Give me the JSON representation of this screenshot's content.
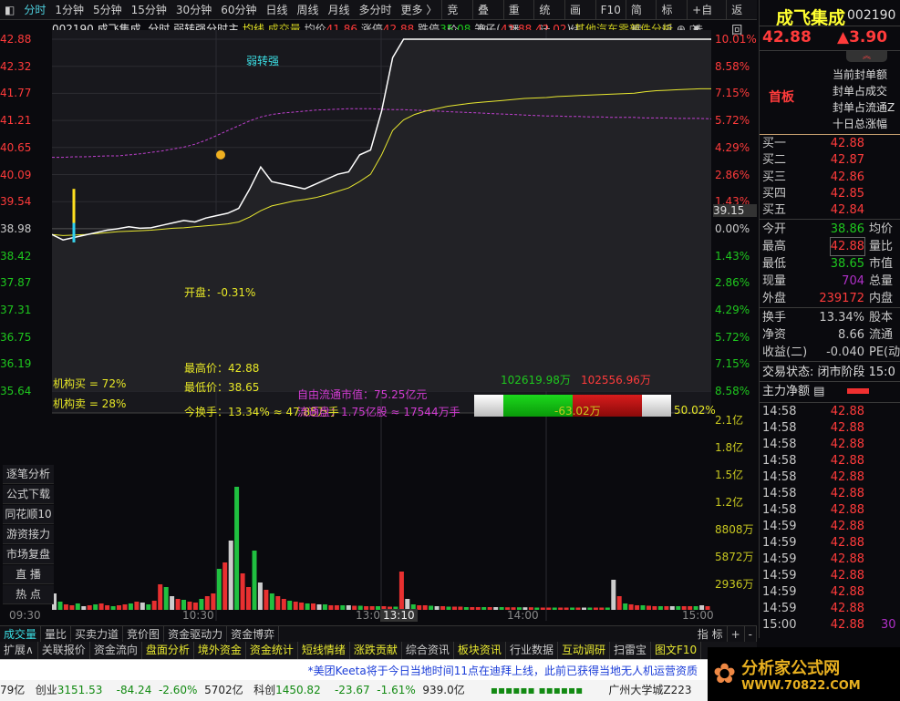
{
  "toolbar": {
    "periods": [
      "分时",
      "1分钟",
      "5分钟",
      "15分钟",
      "30分钟",
      "60分钟",
      "日线",
      "周线",
      "月线",
      "多分时",
      "更多 〉"
    ],
    "buttons": [
      "竞价",
      "叠加",
      "重播",
      "统计",
      "画线",
      "F10",
      "简框",
      "标记",
      "+自选",
      "返回"
    ]
  },
  "info": {
    "code_name": "002190 成飞集成",
    "mode": "分时",
    "formula": "弱转强分时主",
    "avg_line": "均线",
    "volume": "成交量",
    "avg_label": "均价",
    "avg": "41.86",
    "up_label": "涨停",
    "up": "42.88",
    "down_label": "跌停",
    "down": "35.08",
    "cage_label": "笼子(",
    "cage1": "42.88",
    "cage2": "42.02",
    "cage_end": ")",
    "sector": "其他汽车零部件分析"
  },
  "left_axis": [
    "42.88",
    "42.32",
    "41.77",
    "41.21",
    "40.65",
    "40.09",
    "39.54",
    "38.98",
    "38.42",
    "37.87",
    "37.31",
    "36.75",
    "36.19",
    "35.64"
  ],
  "right_axis": [
    "10.01%",
    "8.58%",
    "7.15%",
    "5.72%",
    "4.29%",
    "2.86%",
    "1.43%",
    "0.00%",
    "1.43%",
    "2.86%",
    "4.29%",
    "5.72%",
    "7.15%",
    "8.58%"
  ],
  "cursor_price": "39.15",
  "annotations": {
    "weak_strong": "弱转强",
    "open": "开盘：-0.31%",
    "high": "最高价：42.88",
    "low": "最低价：38.65",
    "turnover": "今换手：13.34% ≈ 47.85万手",
    "free_float": "自由流通市值：75.25亿元",
    "float_shares": "流通盘：1.75亿股 ≈ 17544万手",
    "inst_buy": "机构买 = 72%",
    "inst_sell": "机构卖 = 28%",
    "buy_amt": "102619.98万",
    "sell_amt": "102556.96万",
    "net": "-63.02万",
    "ratio": "50.02%"
  },
  "vol_axis": [
    "2.1亿",
    "1.8亿",
    "1.5亿",
    "1.2亿",
    "8808万",
    "5872万",
    "2936万"
  ],
  "time_axis": [
    "09:30",
    "10:30",
    "13:00",
    "14:00",
    "15:00"
  ],
  "cursor_time": "13:10",
  "side_buttons": [
    "逐笔分析",
    "公式下载",
    "同花顺10",
    "游资接力",
    "市场复盘",
    "直 播",
    "热 点"
  ],
  "chart_data": {
    "type": "line",
    "prev_close": 38.98,
    "ylim": [
      35.64,
      42.88
    ],
    "price": [
      38.86,
      38.75,
      38.8,
      38.85,
      38.9,
      38.95,
      38.98,
      39.02,
      38.99,
      39.0,
      39.05,
      39.1,
      39.15,
      39.12,
      39.2,
      39.25,
      39.3,
      39.4,
      39.8,
      40.25,
      39.95,
      39.9,
      39.85,
      39.8,
      39.9,
      40.0,
      40.1,
      40.15,
      40.5,
      40.6,
      41.4,
      42.5,
      42.88,
      42.88,
      42.88,
      42.88,
      42.88,
      42.88,
      42.88,
      42.88,
      42.88,
      42.88,
      42.88,
      42.88,
      42.88,
      42.88,
      42.88,
      42.88,
      42.88,
      42.88,
      42.88,
      42.88,
      42.88,
      42.88,
      42.88,
      42.88,
      42.88,
      42.88,
      42.88,
      42.88,
      42.88
    ],
    "avg": [
      38.86,
      38.84,
      38.85,
      38.86,
      38.88,
      38.9,
      38.92,
      38.93,
      38.94,
      38.95,
      38.97,
      38.99,
      39.0,
      39.02,
      39.04,
      39.06,
      39.08,
      39.12,
      39.22,
      39.35,
      39.45,
      39.5,
      39.55,
      39.58,
      39.62,
      39.68,
      39.75,
      39.82,
      39.95,
      40.1,
      40.5,
      41.0,
      41.22,
      41.33,
      41.4,
      41.45,
      41.5,
      41.53,
      41.56,
      41.58,
      41.6,
      41.62,
      41.64,
      41.66,
      41.67,
      41.68,
      41.7,
      41.71,
      41.72,
      41.73,
      41.74,
      41.75,
      41.76,
      41.77,
      41.8,
      41.82,
      41.83,
      41.84,
      41.85,
      41.86,
      41.86
    ],
    "ma": [
      40.45,
      40.45,
      40.46,
      40.46,
      40.47,
      40.48,
      40.48,
      40.5,
      40.52,
      40.55,
      40.58,
      40.62,
      40.66,
      40.72,
      40.8,
      40.9,
      41.0,
      41.1,
      41.2,
      41.28,
      41.33,
      41.36,
      41.38,
      41.4,
      41.42,
      41.43,
      41.44,
      41.45,
      41.45,
      41.45,
      41.44,
      41.43,
      41.43,
      41.42,
      41.41,
      41.4,
      41.39,
      41.38,
      41.37,
      41.36,
      41.35,
      41.34,
      41.33,
      41.32,
      41.31,
      41.3,
      41.3,
      41.29,
      41.29,
      41.28,
      41.28,
      41.27,
      41.27,
      41.27,
      41.26,
      41.26,
      41.26,
      41.25,
      41.25,
      41.25,
      41.24
    ],
    "volume_wan": [
      1800,
      900,
      600,
      500,
      700,
      400,
      500,
      600,
      700,
      500,
      400,
      500,
      600,
      700,
      900,
      800,
      600,
      1000,
      2800,
      2500,
      1500,
      1200,
      1100,
      900,
      800,
      1200,
      1500,
      1800,
      4500,
      5200,
      7600,
      13500,
      4000,
      2500,
      6500,
      3000,
      2200,
      1800,
      1500,
      1200,
      1000,
      900,
      800,
      700,
      700,
      600,
      600,
      500,
      500,
      500,
      500,
      450,
      450,
      400,
      400,
      400,
      400,
      350,
      350,
      4200,
      1200,
      600,
      500,
      500,
      450,
      400,
      400,
      350,
      350,
      350,
      300,
      300,
      300,
      300,
      300,
      300,
      300,
      280,
      280,
      280,
      280,
      280,
      250,
      250,
      250,
      250,
      250,
      250,
      250,
      250,
      250,
      250,
      250,
      250,
      250,
      3300,
      1500,
      700,
      600,
      500,
      500,
      450,
      400,
      400,
      400,
      400,
      400,
      400,
      400,
      400,
      500,
      400
    ]
  },
  "quote": {
    "name": "成飞集成",
    "code": "002190",
    "price": "42.88",
    "change": "▲3.90",
    "board": "首板",
    "seal": [
      "当前封单额",
      "封单占成交",
      "封单占流通Z",
      "十日总涨幅"
    ],
    "bids": [
      [
        "买一",
        "42.88"
      ],
      [
        "买二",
        "42.87"
      ],
      [
        "买三",
        "42.86"
      ],
      [
        "买四",
        "42.85"
      ],
      [
        "买五",
        "42.84"
      ]
    ],
    "stats": [
      [
        "今开",
        "38.86",
        "均价"
      ],
      [
        "最高",
        "42.88",
        "量比"
      ],
      [
        "最低",
        "38.65",
        "市值"
      ],
      [
        "现量",
        "704",
        "总量"
      ],
      [
        "外盘",
        "239172",
        "内盘"
      ]
    ],
    "stats2": [
      [
        "换手",
        "13.34%",
        "股本"
      ],
      [
        "净资",
        "8.66",
        "流通"
      ],
      [
        "收益(二)",
        "-0.040",
        "PE(动"
      ]
    ],
    "status": "交易状态: 闭市阶段 15:0",
    "net_label": "主力净额",
    "ticks": [
      [
        "14:58",
        "42.88"
      ],
      [
        "14:58",
        "42.88"
      ],
      [
        "14:58",
        "42.88"
      ],
      [
        "14:58",
        "42.88"
      ],
      [
        "14:58",
        "42.88"
      ],
      [
        "14:58",
        "42.88"
      ],
      [
        "14:58",
        "42.88"
      ],
      [
        "14:59",
        "42.88"
      ],
      [
        "14:59",
        "42.88"
      ],
      [
        "14:59",
        "42.88"
      ],
      [
        "14:59",
        "42.88"
      ],
      [
        "14:59",
        "42.88"
      ],
      [
        "14:59",
        "42.88"
      ],
      [
        "15:00",
        "42.88"
      ]
    ],
    "last_vol": "30"
  },
  "bottom_tabs": [
    "成交量",
    "量比",
    "买卖力道",
    "竞价图",
    "资金驱动力",
    "资金博弈"
  ],
  "index_btn": "指 标",
  "info_tabs": [
    "扩展∧",
    "关联报价",
    "资金流向",
    "盘面分析",
    "境外资金",
    "资金统计",
    "短线情绪",
    "涨跌贡献",
    "综合资讯",
    "板块资讯",
    "行业数据",
    "互动调研",
    "扫雷宝",
    "图文F10"
  ],
  "news": "*美团Keeta将于今日当地时间11点在迪拜上线，此前已获得当地无人机运营资质",
  "statusbar": {
    "a": "79亿",
    "cy": "创业",
    "cy_v": "3151.53",
    "cy_c": "-84.24",
    "cy_p": "-2.60%",
    "cy_a": "5702亿",
    "kc": "科创",
    "kc_v": "1450.82",
    "kc_c": "-23.67",
    "kc_p": "-1.61%",
    "kc_a": "939.0亿",
    "loc": "广州大学城Z223"
  },
  "watermark": {
    "title": "分析家公式网",
    "url": "WWW.70822.COM"
  }
}
